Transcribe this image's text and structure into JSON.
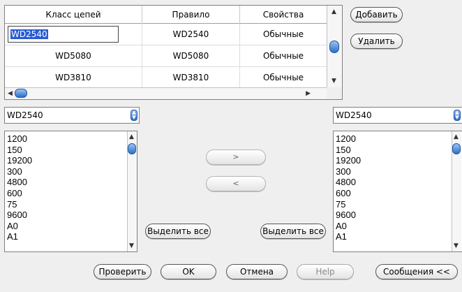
{
  "table": {
    "columns": [
      "Класс цепей",
      "Правило",
      "Свойства"
    ],
    "rows": [
      {
        "class": "WD2540",
        "rule": "WD2540",
        "props": "Обычные",
        "editing": true
      },
      {
        "class": "WD5080",
        "rule": "WD5080",
        "props": "Обычные"
      },
      {
        "class": "WD3810",
        "rule": "WD3810",
        "props": "Обычные"
      }
    ]
  },
  "side_buttons": {
    "add": "Добавить",
    "remove": "Удалить"
  },
  "left_panel": {
    "combo_value": "WD2540",
    "items": [
      "1200",
      "150",
      "19200",
      "300",
      "4800",
      "600",
      "75",
      "9600",
      "A0",
      "A1"
    ],
    "select_all": "Выделить все"
  },
  "right_panel": {
    "combo_value": "WD2540",
    "items": [
      "1200",
      "150",
      "19200",
      "300",
      "4800",
      "600",
      "75",
      "9600",
      "A0",
      "A1"
    ],
    "select_all": "Выделить все"
  },
  "transfer": {
    "move_right": ">",
    "move_left": "<"
  },
  "footer": {
    "check": "Проверить",
    "ok": "OK",
    "cancel": "Отмена",
    "help": "Help",
    "messages": "Сообщения <<"
  },
  "colors": {
    "selection": "#2a5bd7",
    "thumb": "#2b6fc9",
    "background": "#efefef"
  }
}
